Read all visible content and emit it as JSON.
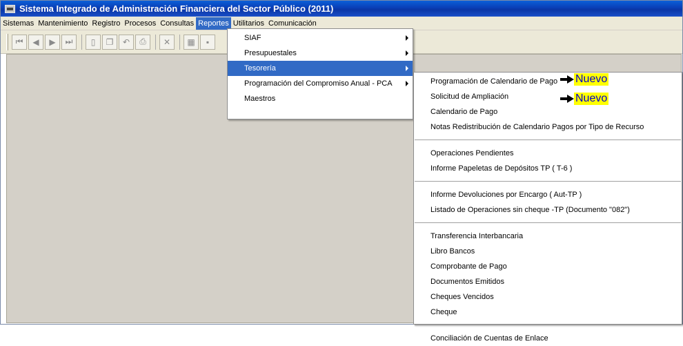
{
  "window": {
    "title": "Sistema Integrado de Administración Financiera del Sector Público (2011)"
  },
  "menubar": [
    "Sistemas",
    "Mantenimiento",
    "Registro",
    "Procesos",
    "Consultas",
    "Reportes",
    "Utilitarios",
    "Comunicación"
  ],
  "active_menu": "Reportes",
  "toolbar_icons": [
    "first-record-icon",
    "previous-record-icon",
    "next-record-icon",
    "last-record-icon",
    "new-document-icon",
    "copy-icon",
    "undo-icon",
    "print-icon",
    "delete-icon",
    "settings-icon",
    "save-icon"
  ],
  "reportes_menu": {
    "items": [
      {
        "label": "SIAF",
        "submenu": true
      },
      {
        "label": "Presupuestales",
        "submenu": true
      },
      {
        "label": "Tesorería",
        "submenu": true,
        "highlighted": true
      },
      {
        "label": "Programación del Compromiso Anual - PCA",
        "submenu": true
      },
      {
        "label": "Maestros",
        "submenu": false
      }
    ]
  },
  "tesoreria_menu": {
    "groups": [
      [
        "Programación de Calendario de Pago",
        "Solicitud de Ampliación",
        "Calendario de Pago",
        "Notas Redistribución de Calendario Pagos por Tipo de Recurso"
      ],
      [
        "Operaciones Pendientes",
        "Informe Papeletas de Depósitos TP ( T-6 )"
      ],
      [
        "Informe Devoluciones por Encargo ( Aut-TP )",
        "Listado de Operaciones sin cheque -TP (Documento \"082\")"
      ],
      [
        "Transferencia Interbancaria",
        "Libro Bancos",
        "Comprobante de Pago",
        "Documentos Emitidos",
        "Cheques Vencidos",
        "Cheque"
      ],
      [
        "Conciliación de Cuentas de Enlace"
      ]
    ]
  },
  "annotations": {
    "new_label": "Nuevo",
    "highlight_color": "#ffff00",
    "text_color": "#0000cc"
  }
}
